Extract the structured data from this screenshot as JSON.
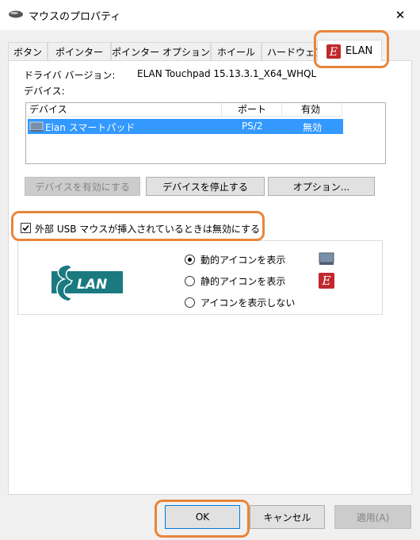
{
  "window": {
    "title": "マウスのプロパティ",
    "close_glyph": "✕"
  },
  "tabs": [
    {
      "label": "ボタン"
    },
    {
      "label": "ポインター"
    },
    {
      "label": "ポインター オプション"
    },
    {
      "label": "ホイール"
    },
    {
      "label": "ハードウェア"
    },
    {
      "label": "ELAN",
      "active": true
    }
  ],
  "driver": {
    "label": "ドライバ バージョン:",
    "value": "ELAN Touchpad 15.13.3.1_X64_WHQL"
  },
  "devices": {
    "label": "デバイス:",
    "columns": [
      "デバイス",
      "ポート",
      "有効"
    ],
    "rows": [
      {
        "device": "Elan スマートパッド",
        "port": "PS/2",
        "enabled": "無効",
        "selected": true
      }
    ]
  },
  "buttons": {
    "enable": "デバイスを有効にする",
    "stop": "デバイスを停止する",
    "options": "オプション..."
  },
  "usb_disable": {
    "label": "外部 USB マウスが挿入されているときは無効にする",
    "checked": true
  },
  "logo_text": "LAN",
  "icon_options": [
    {
      "label": "動的アイコンを表示",
      "checked": true,
      "icon": "monitor-icon"
    },
    {
      "label": "静的アイコンを表示",
      "checked": false,
      "icon": "elan-e-icon"
    },
    {
      "label": "アイコンを表示しない",
      "checked": false
    }
  ],
  "footer": {
    "ok": "OK",
    "cancel": "キャンセル",
    "apply": "適用(A)"
  },
  "colors": {
    "highlight": "#e8853a",
    "selection": "#3399ff",
    "elan_teal": "#1a7a80",
    "elan_red": "#c0282d"
  }
}
